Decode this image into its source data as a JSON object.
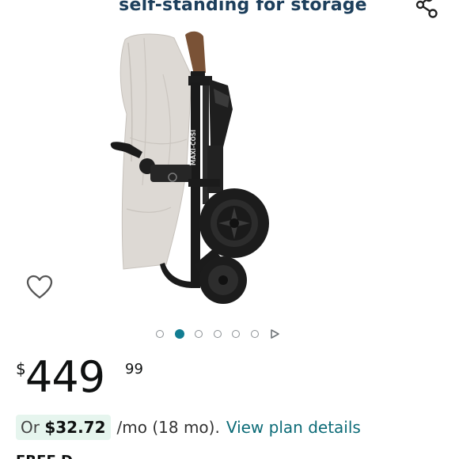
{
  "header": {
    "image_caption": "self-standing for storage"
  },
  "icons": {
    "share": "share-icon",
    "wishlist": "heart-icon",
    "carousel_next": "play-icon"
  },
  "product": {
    "brand_mark": "MAXI-COSI"
  },
  "carousel": {
    "total": 6,
    "active_index": 1
  },
  "price": {
    "symbol": "$",
    "whole": "449",
    "fraction": "99"
  },
  "plan": {
    "prefix": "Or",
    "amount": "$32.72",
    "term": "/mo (18 mo).",
    "link": "View plan details"
  },
  "delivery": {
    "partial_text": "FREE D"
  },
  "colors": {
    "caption": "#1d3f5c",
    "accent_teal": "#127d92",
    "link": "#0c6b77",
    "plan_bg": "#e6f5ee"
  }
}
